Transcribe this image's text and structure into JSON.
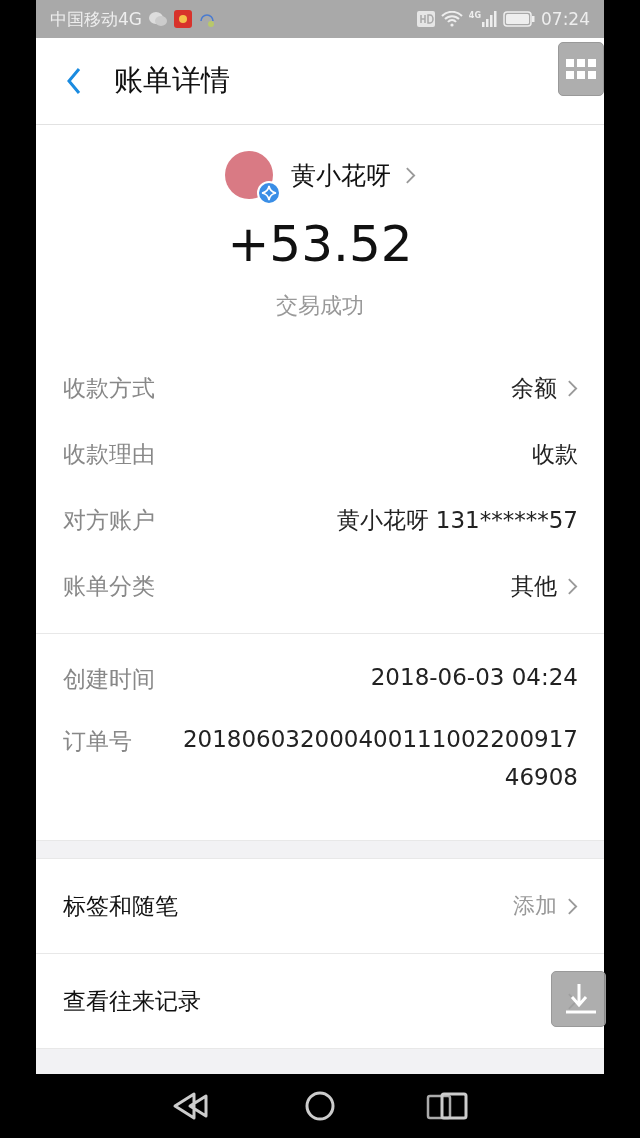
{
  "status_bar": {
    "carrier": "中国移动4G",
    "network_badge": "4G",
    "time": "07:24"
  },
  "header": {
    "title": "账单详情"
  },
  "payee": {
    "name": "黄小花呀",
    "verified": true
  },
  "amount": "+53.52",
  "status": "交易成功",
  "details": [
    {
      "label": "收款方式",
      "value": "余额",
      "link": true
    },
    {
      "label": "收款理由",
      "value": "收款",
      "link": false
    },
    {
      "label": "对方账户",
      "value": "黄小花呀 131******57",
      "link": false
    },
    {
      "label": "账单分类",
      "value": "其他",
      "link": true
    }
  ],
  "meta": [
    {
      "label": "创建时间",
      "value": "2018-06-03 04:24"
    },
    {
      "label": "订单号",
      "value": "20180603200040011100220091746908"
    }
  ],
  "actions": [
    {
      "label": "标签和随笔",
      "value": "添加",
      "link": true
    },
    {
      "label": "查看往来记录",
      "link": true
    }
  ]
}
